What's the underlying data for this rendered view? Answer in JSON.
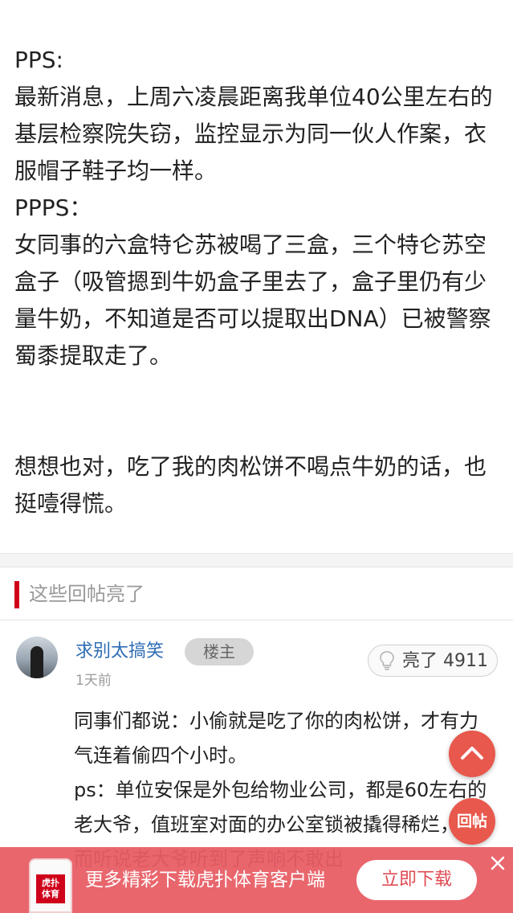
{
  "post": {
    "paragraphs": [
      "PPS:",
      "最新消息，上周六凌晨距离我单位40公里左右的基层检察院失窃，监控显示为同一伙人作案，衣服帽子鞋子均一样。",
      "PPPS：",
      "女同事的六盒特仑苏被喝了三盒，三个特仑苏空盒子（吸管摁到牛奶盒子里去了，盒子里仍有少量牛奶，不知道是否可以提取出DNA）已被警察蜀黍提取走了。",
      "想想也对，吃了我的肉松饼不喝点牛奶的话，也挺噎得慌。"
    ]
  },
  "section": {
    "title": "这些回帖亮了"
  },
  "reply": {
    "username": "求别太搞笑",
    "badge": "楼主",
    "time": "1天前",
    "light_label": "亮了",
    "light_count": "4911",
    "paragraphs": [
      "同事们都说：小偷就是吃了你的肉松饼，才有力气连着偷四个小时。",
      "ps：单位安保是外包给物业公司，都是60左右的老大爷，值班室对面的办公室锁被撬得稀烂，然而听说老大爷听到了声响不敢出"
    ]
  },
  "fab": {
    "up_icon": "chevron-up-icon",
    "reply_label": "回帖"
  },
  "banner": {
    "app_logo_text": "虎扑\n体育",
    "text": "更多精彩下载虎扑体育客户端",
    "button": "立即下载",
    "close_icon": "close-icon"
  },
  "colors": {
    "accent": "#d0021b",
    "link": "#2e6db4",
    "fab": "#e8584c",
    "banner": "#e85c64"
  }
}
